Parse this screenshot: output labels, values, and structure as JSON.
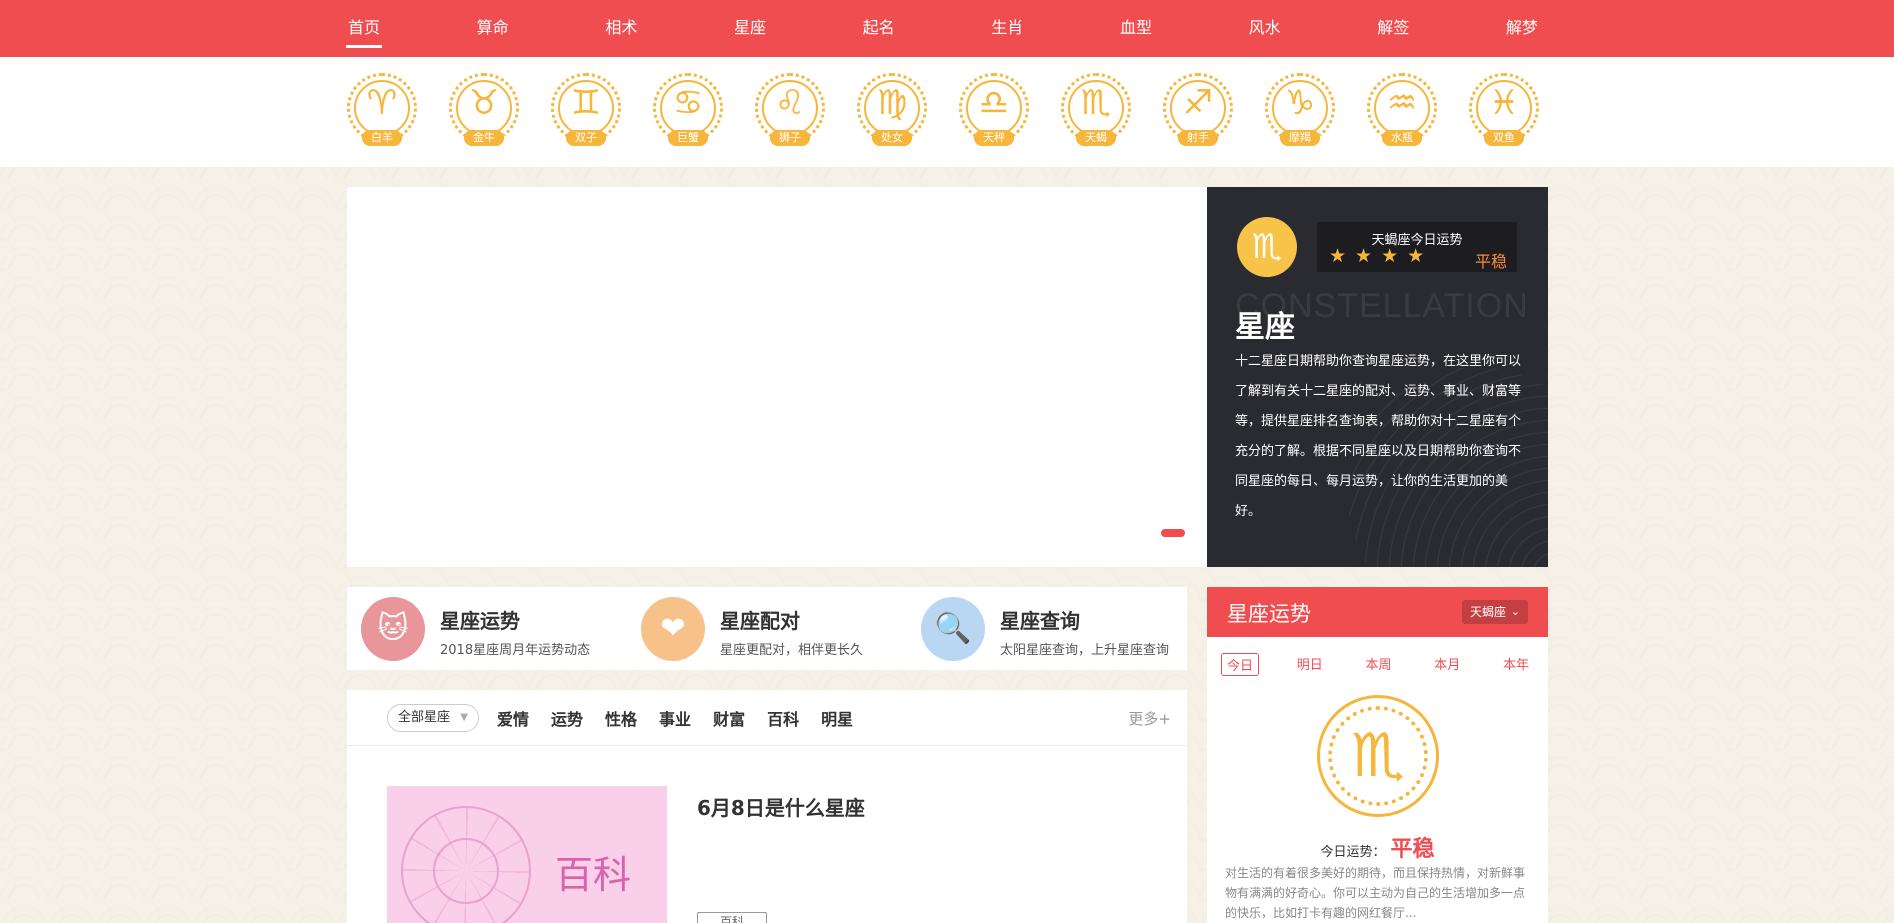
{
  "nav": {
    "items": [
      "首页",
      "算命",
      "相术",
      "星座",
      "起名",
      "生肖",
      "血型",
      "风水",
      "解签",
      "解梦"
    ],
    "active_index": 0
  },
  "zodiac": [
    {
      "glyph": "♈",
      "name": "白羊"
    },
    {
      "glyph": "♉",
      "name": "金牛"
    },
    {
      "glyph": "♊",
      "name": "双子"
    },
    {
      "glyph": "♋",
      "name": "巨蟹"
    },
    {
      "glyph": "♌",
      "name": "狮子"
    },
    {
      "glyph": "♍",
      "name": "处女"
    },
    {
      "glyph": "♎",
      "name": "天秤"
    },
    {
      "glyph": "♏",
      "name": "天蝎"
    },
    {
      "glyph": "♐",
      "name": "射手"
    },
    {
      "glyph": "♑",
      "name": "摩羯"
    },
    {
      "glyph": "♒",
      "name": "水瓶"
    },
    {
      "glyph": "♓",
      "name": "双鱼"
    }
  ],
  "panel": {
    "glyph": "♏",
    "today_title": "天蝎座今日运势",
    "stars": 4,
    "level": "平稳",
    "watermark": "CONSTELLATION",
    "title": "星座",
    "desc": "十二星座日期帮助你查询星座运势，在这里你可以了解到有关十二星座的配对、运势、事业、财富等等，提供星座排名查询表，帮助你对十二星座有个充分的了解。根据不同星座以及日期帮助你查询不同星座的每日、每月运势，让你的生活更加的美好。"
  },
  "features": [
    {
      "icon": "lucky-cat-icon",
      "glyph": "🐱",
      "color": "#e8969a",
      "title": "星座运势",
      "sub": "2018星座周月年运势动态"
    },
    {
      "icon": "hearts-icon",
      "glyph": "❤",
      "color": "#f7c28a",
      "title": "星座配对",
      "sub": "星座更配对，相伴更长久"
    },
    {
      "icon": "search-icon",
      "glyph": "🔍",
      "color": "#b9d6f2",
      "title": "星座查询",
      "sub": "太阳星座查询，上升星座查询"
    }
  ],
  "filter": {
    "select_label": "全部星座",
    "tabs": [
      "爱情",
      "运势",
      "性格",
      "事业",
      "财富",
      "百科",
      "明星"
    ],
    "more": "更多+"
  },
  "article": {
    "thumb_label": "百科",
    "title": "6月8日是什么星座",
    "tag": "百科"
  },
  "fortune": {
    "title": "星座运势",
    "select": "天蝎座",
    "periods": [
      "今日",
      "明日",
      "本周",
      "本月",
      "本年"
    ],
    "active_period": 0,
    "glyph": "♏",
    "today_label": "今日运势：",
    "today_value": "平稳",
    "desc": "对生活的有着很多美好的期待，而且保持热情，对新鲜事物有满满的好奇心。你可以主动为自己的生活增加多一点的快乐，比如打卡有趣的网红餐厅..."
  },
  "colors": {
    "brand_red": "#ef4d50",
    "gold": "#f5b63b",
    "dark_panel": "#2a2a31"
  }
}
